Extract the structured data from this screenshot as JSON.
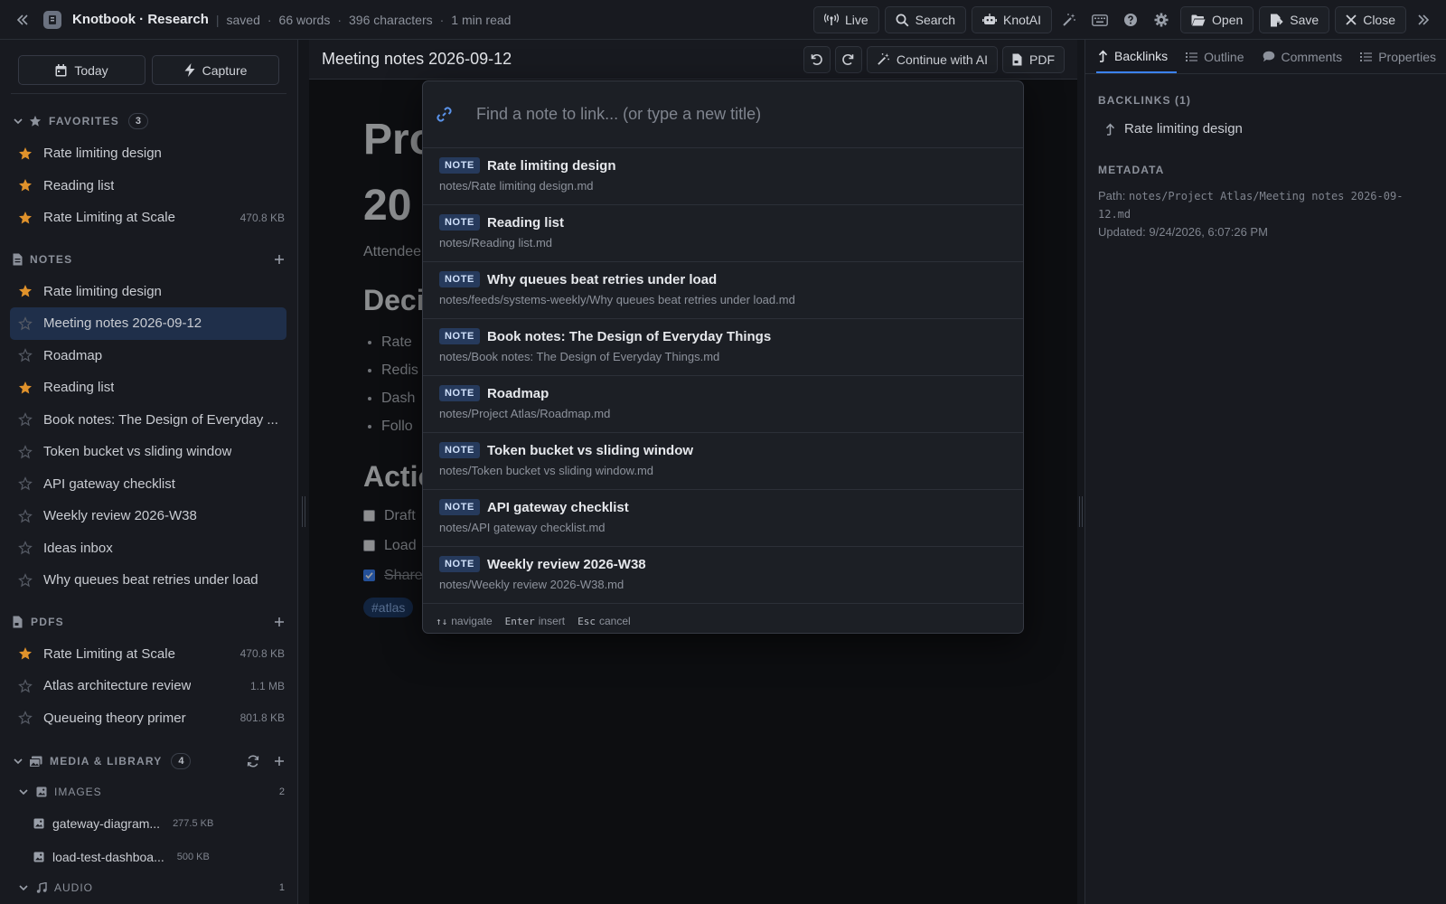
{
  "topbar": {
    "app_name": "Knotbook · Research",
    "status": "saved",
    "words": "66 words",
    "characters": "396 characters",
    "read_time": "1 min read",
    "buttons": {
      "live": "Live",
      "search": "Search",
      "ai": "KnotAI",
      "open": "Open",
      "save": "Save",
      "close": "Close"
    }
  },
  "sidebar": {
    "today": "Today",
    "capture": "Capture",
    "favorites": {
      "title": "FAVORITES",
      "count": "3",
      "items": [
        {
          "label": "Rate limiting design",
          "size": ""
        },
        {
          "label": "Reading list",
          "size": ""
        },
        {
          "label": "Rate Limiting at Scale",
          "size": "470.8 KB"
        }
      ]
    },
    "notes": {
      "title": "NOTES",
      "items": [
        {
          "label": "Rate limiting design",
          "starred": true
        },
        {
          "label": "Meeting notes 2026-09-12",
          "starred": false,
          "active": true
        },
        {
          "label": "Roadmap",
          "starred": false
        },
        {
          "label": "Reading list",
          "starred": true
        },
        {
          "label": "Book notes: The Design of Everyday ...",
          "starred": false
        },
        {
          "label": "Token bucket vs sliding window",
          "starred": false
        },
        {
          "label": "API gateway checklist",
          "starred": false
        },
        {
          "label": "Weekly review 2026-W38",
          "starred": false
        },
        {
          "label": "Ideas inbox",
          "starred": false
        },
        {
          "label": "Why queues beat retries under load",
          "starred": false
        }
      ]
    },
    "pdfs": {
      "title": "PDFS",
      "items": [
        {
          "label": "Rate Limiting at Scale",
          "size": "470.8 KB",
          "starred": true
        },
        {
          "label": "Atlas architecture review",
          "size": "1.1 MB",
          "starred": false
        },
        {
          "label": "Queueing theory primer",
          "size": "801.8 KB",
          "starred": false
        }
      ]
    },
    "media": {
      "title": "MEDIA & LIBRARY",
      "count": "4",
      "images_title": "IMAGES",
      "images_count": "2",
      "images": [
        {
          "label": "gateway-diagram...",
          "size": "277.5 KB"
        },
        {
          "label": "load-test-dashboa...",
          "size": "500 KB"
        }
      ],
      "audio_title": "AUDIO",
      "audio_count": "1"
    }
  },
  "editor": {
    "tab_title": "Meeting notes 2026-09-12",
    "continue_ai": "Continue with AI",
    "pdf": "PDF",
    "heading_partial_1": "Pro",
    "heading_partial_2": "20",
    "attendees_partial": "Attendee",
    "decisions_partial": "Deci",
    "bullets": [
      "Rate",
      "Redis",
      "Dash",
      "Follo"
    ],
    "actions_partial": "Actio",
    "tasks": [
      {
        "label": "Draft",
        "checked": false
      },
      {
        "label": "Load",
        "checked": false
      },
      {
        "label": "Share",
        "checked": true
      }
    ],
    "tag": "#atlas"
  },
  "right_panel": {
    "tabs": [
      "Backlinks",
      "Outline",
      "Comments",
      "Properties"
    ],
    "backlinks_title": "BACKLINKS (1)",
    "backlink": "Rate limiting design",
    "metadata_title": "METADATA",
    "path_label": "Path:",
    "path_value": "notes/Project Atlas/Meeting notes 2026-09-12.md",
    "updated": "Updated: 9/24/2026, 6:07:26 PM"
  },
  "link_picker": {
    "placeholder": "Find a note to link... (or type a new title)",
    "badge": "NOTE",
    "results": [
      {
        "title": "Rate limiting design",
        "path": "notes/Rate limiting design.md"
      },
      {
        "title": "Reading list",
        "path": "notes/Reading list.md"
      },
      {
        "title": "Why queues beat retries under load",
        "path": "notes/feeds/systems-weekly/Why queues beat retries under load.md"
      },
      {
        "title": "Book notes: The Design of Everyday Things",
        "path": "notes/Book notes: The Design of Everyday Things.md"
      },
      {
        "title": "Roadmap",
        "path": "notes/Project Atlas/Roadmap.md"
      },
      {
        "title": "Token bucket vs sliding window",
        "path": "notes/Token bucket vs sliding window.md"
      },
      {
        "title": "API gateway checklist",
        "path": "notes/API gateway checklist.md"
      },
      {
        "title": "Weekly review 2026-W38",
        "path": "notes/Weekly review 2026-W38.md"
      }
    ],
    "footer": {
      "nav_key": "↑↓",
      "nav_label": "navigate",
      "insert_key": "Enter",
      "insert_label": "insert",
      "cancel_key": "Esc",
      "cancel_label": "cancel"
    }
  },
  "colors": {
    "accent": "#3b82f6",
    "star": "#e0922b",
    "active_bg": "#1f2f4a"
  }
}
